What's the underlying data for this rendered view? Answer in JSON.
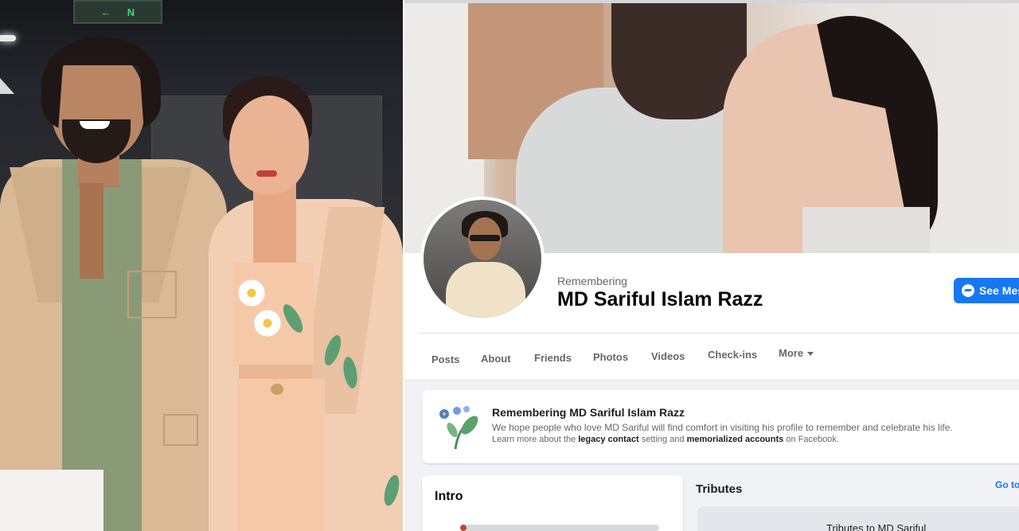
{
  "left_photo": {
    "exit_sign_arrow": "←",
    "exit_sign_text": "N"
  },
  "profile": {
    "remembering_label": "Remembering",
    "name": "MD Sariful Islam Razz",
    "message_button_label": "See Mes",
    "message_icon": "messenger-icon"
  },
  "tabs": [
    {
      "label": "Posts"
    },
    {
      "label": "About"
    },
    {
      "label": "Friends"
    },
    {
      "label": "Photos"
    },
    {
      "label": "Videos"
    },
    {
      "label": "Check-ins"
    },
    {
      "label": "More"
    }
  ],
  "memorial": {
    "title": "Remembering MD Sariful Islam Razz",
    "text": "We hope people who love MD Sariful will find comfort in visiting his profile to remember and celebrate his life.",
    "learn_prefix": "Learn more about the ",
    "legacy_link": "legacy contact",
    "learn_middle": " setting and ",
    "memorialized_link": "memorialized accounts",
    "learn_suffix": " on Facebook."
  },
  "intro": {
    "title": "Intro"
  },
  "tributes": {
    "title": "Tributes",
    "goto_label": "Go to",
    "card_text": "Tributes to MD Sariful"
  }
}
